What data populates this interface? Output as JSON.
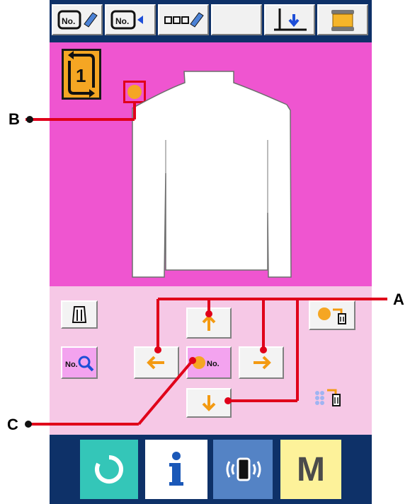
{
  "header_buttons": [
    {
      "id": "no-edit",
      "label": "No."
    },
    {
      "id": "no-next",
      "label": "No."
    },
    {
      "id": "text-edit",
      "label": "ooo"
    },
    {
      "id": "blank",
      "label": ""
    },
    {
      "id": "thread-down",
      "label": ""
    },
    {
      "id": "bobbin",
      "label": ""
    }
  ],
  "pattern": {
    "number": "1"
  },
  "callouts": {
    "a": "A",
    "b": "B",
    "c": "C"
  },
  "controls": {
    "pattern_search_label": "No.",
    "origin_label": "No."
  },
  "bottom_bar": {
    "menu_label": "M"
  },
  "colors": {
    "accent": "#f5a623",
    "magenta": "#ef55d0",
    "navy": "#0e3168",
    "teal": "#34c6b8",
    "red": "#e0001a",
    "yellow": "#fdf29a",
    "blue_btn": "#5483c5"
  }
}
